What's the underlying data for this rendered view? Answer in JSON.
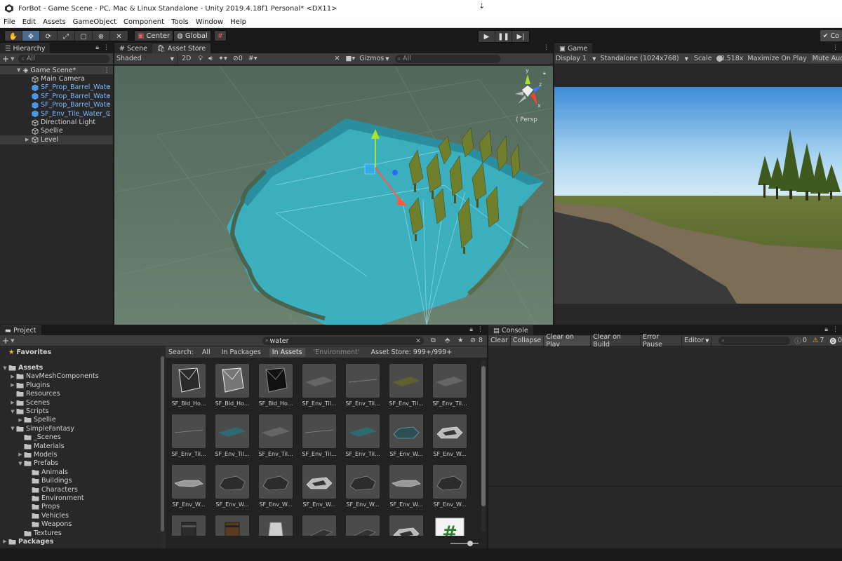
{
  "window": {
    "title": "ForBot - Game Scene - PC, Mac & Linux Standalone - Unity 2019.4.18f1 Personal* <DX11>"
  },
  "menu": [
    "File",
    "Edit",
    "Assets",
    "GameObject",
    "Component",
    "Tools",
    "Window",
    "Help"
  ],
  "toolbar": {
    "center_label": "Center",
    "global_label": "Global",
    "collab_label": "Co"
  },
  "hierarchy": {
    "tab_label": "Hierarchy",
    "search_placeholder": "All",
    "scene_name": "Game Scene*",
    "items": [
      {
        "label": "Main Camera",
        "style": "normal"
      },
      {
        "label": "SF_Prop_Barrel_Wate",
        "style": "blue"
      },
      {
        "label": "SF_Prop_Barrel_Wate",
        "style": "blue"
      },
      {
        "label": "SF_Prop_Barrel_Wate",
        "style": "blue"
      },
      {
        "label": "SF_Env_Tile_Water_C",
        "style": "blue"
      },
      {
        "label": "Directional Light",
        "style": "normal"
      },
      {
        "label": "Spellie",
        "style": "normal"
      },
      {
        "label": "Level",
        "style": "selected"
      }
    ]
  },
  "scene": {
    "tabs": [
      "Scene",
      "Asset Store"
    ],
    "shading": "Shaded",
    "mode_2d": "2D",
    "hidden_count": "0",
    "gizmos": "Gizmos",
    "search_placeholder": "All",
    "persp_label": "Persp",
    "axis_y": "y",
    "axis_z": "z",
    "axis_x": "x"
  },
  "game": {
    "tab_label": "Game",
    "display": "Display 1",
    "resolution": "Standalone (1024x768)",
    "scale_label": "Scale",
    "scale_value": "0.518x",
    "maximize": "Maximize On Play",
    "mute": "Mute Aud"
  },
  "project": {
    "tab_label": "Project",
    "search_value": "water",
    "hidden_count": "8",
    "favorites": "Favorites",
    "search_row": {
      "label": "Search:",
      "options": [
        "All",
        "In Packages",
        "In Assets",
        "'Environment'",
        "Asset Store: 999+/999+"
      ]
    },
    "tree": [
      {
        "label": "Assets",
        "depth": 0,
        "arrow": "down"
      },
      {
        "label": "NavMeshComponents",
        "depth": 1,
        "arrow": "right"
      },
      {
        "label": "Plugins",
        "depth": 1,
        "arrow": "right"
      },
      {
        "label": "Resources",
        "depth": 1,
        "arrow": ""
      },
      {
        "label": "Scenes",
        "depth": 1,
        "arrow": "right"
      },
      {
        "label": "Scripts",
        "depth": 1,
        "arrow": "down"
      },
      {
        "label": "Spellie",
        "depth": 2,
        "arrow": "right"
      },
      {
        "label": "SimpleFantasy",
        "depth": 1,
        "arrow": "down"
      },
      {
        "label": "_Scenes",
        "depth": 2,
        "arrow": ""
      },
      {
        "label": "Materials",
        "depth": 2,
        "arrow": ""
      },
      {
        "label": "Models",
        "depth": 2,
        "arrow": "right"
      },
      {
        "label": "Prefabs",
        "depth": 2,
        "arrow": "down"
      },
      {
        "label": "Animals",
        "depth": 3,
        "arrow": ""
      },
      {
        "label": "Buildings",
        "depth": 3,
        "arrow": ""
      },
      {
        "label": "Characters",
        "depth": 3,
        "arrow": ""
      },
      {
        "label": "Environment",
        "depth": 3,
        "arrow": ""
      },
      {
        "label": "Props",
        "depth": 3,
        "arrow": ""
      },
      {
        "label": "Vehicles",
        "depth": 3,
        "arrow": ""
      },
      {
        "label": "Weapons",
        "depth": 3,
        "arrow": ""
      },
      {
        "label": "Textures",
        "depth": 2,
        "arrow": ""
      },
      {
        "label": "Packages",
        "depth": 0,
        "arrow": "right"
      }
    ],
    "assets": [
      {
        "label": "SF_Bld_Ho...",
        "thumb": "cage-dark"
      },
      {
        "label": "SF_Bld_Ho...",
        "thumb": "cage-light"
      },
      {
        "label": "SF_Bld_Ho...",
        "thumb": "cage-black"
      },
      {
        "label": "SF_Env_Til...",
        "thumb": "plane-grey"
      },
      {
        "label": "SF_Env_Til...",
        "thumb": "line"
      },
      {
        "label": "SF_Env_Til...",
        "thumb": "plane-olive"
      },
      {
        "label": "SF_Env_Til...",
        "thumb": "plane-grey"
      },
      {
        "label": "SF_Env_Til...",
        "thumb": "line"
      },
      {
        "label": "SF_Env_Til...",
        "thumb": "plane-teal"
      },
      {
        "label": "SF_Env_Til...",
        "thumb": "plane-grey"
      },
      {
        "label": "SF_Env_Til...",
        "thumb": "line"
      },
      {
        "label": "SF_Env_Til...",
        "thumb": "plane-teal"
      },
      {
        "label": "SF_Env_W...",
        "thumb": "rock-teal"
      },
      {
        "label": "SF_Env_W...",
        "thumb": "rock-light"
      },
      {
        "label": "SF_Env_W...",
        "thumb": "rock-flat"
      },
      {
        "label": "SF_Env_W...",
        "thumb": "rock-dark"
      },
      {
        "label": "SF_Env_W...",
        "thumb": "rock-dark"
      },
      {
        "label": "SF_Env_W...",
        "thumb": "rock-light"
      },
      {
        "label": "SF_Env_W...",
        "thumb": "rock-dark"
      },
      {
        "label": "SF_Env_W...",
        "thumb": "rock-flat"
      },
      {
        "label": "SF_Env_W...",
        "thumb": "rock-dark"
      },
      {
        "label": "",
        "thumb": "barrel"
      },
      {
        "label": "",
        "thumb": "barrel-brown"
      },
      {
        "label": "",
        "thumb": "barrel-light"
      },
      {
        "label": "",
        "thumb": "slab"
      },
      {
        "label": "",
        "thumb": "slab"
      },
      {
        "label": "",
        "thumb": "rock-light"
      },
      {
        "label": "",
        "thumb": "script"
      }
    ]
  },
  "console": {
    "tab_label": "Console",
    "buttons": [
      "Clear",
      "Collapse",
      "Clear on Play",
      "Clear on Build",
      "Error Pause",
      "Editor"
    ],
    "active_buttons": [
      "Collapse",
      "Clear on Play"
    ],
    "info_count": "0",
    "warn_count": "7",
    "error_count": "0"
  }
}
